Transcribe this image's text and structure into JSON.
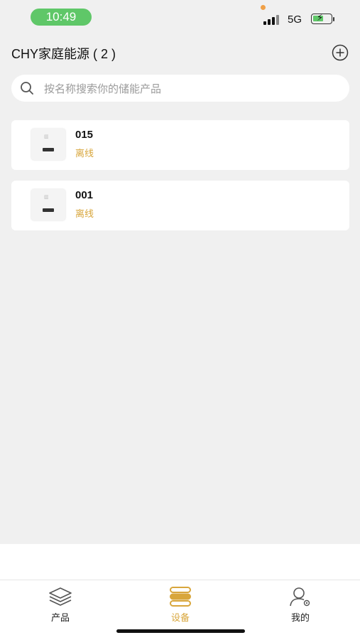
{
  "status_bar": {
    "time": "10:49",
    "network": "5G"
  },
  "header": {
    "title": "CHY家庭能源 ( 2 )"
  },
  "search": {
    "placeholder": "按名称搜索你的储能产品"
  },
  "devices": [
    {
      "name": "015",
      "status": "离线"
    },
    {
      "name": "001",
      "status": "离线"
    }
  ],
  "tabs": [
    {
      "label": "产品",
      "icon": "layers-icon",
      "active": false
    },
    {
      "label": "设备",
      "icon": "device-stack-icon",
      "active": true
    },
    {
      "label": "我的",
      "icon": "user-settings-icon",
      "active": false
    }
  ],
  "colors": {
    "accent": "#d8a63c",
    "time_pill": "#5fc768",
    "background": "#f0f0f0"
  }
}
